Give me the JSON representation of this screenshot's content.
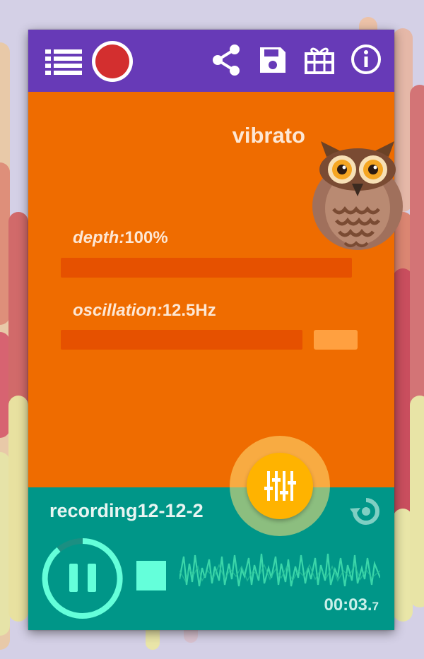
{
  "toolbar": {
    "icons": [
      "playlist-icon",
      "record-icon",
      "share-icon",
      "save-icon",
      "gift-icon",
      "info-icon"
    ],
    "accent": "#673ab7"
  },
  "effect": {
    "title": "vibrato",
    "mascot": "owl",
    "background": "#ef6c00"
  },
  "params": [
    {
      "key": "depth:",
      "value": "100%",
      "level": 1.0
    },
    {
      "key": "oscillation:",
      "value": "12.5Hz",
      "level": 0.85
    }
  ],
  "player": {
    "file_name": "recording12-12-2",
    "time_main": "00:03.",
    "time_fraction": "7",
    "background": "#009688",
    "icons": [
      "pause-icon",
      "stop-icon",
      "waveform",
      "replay-icon"
    ]
  },
  "fab": {
    "icon": "equalizer-icon",
    "color": "#ffb300"
  }
}
